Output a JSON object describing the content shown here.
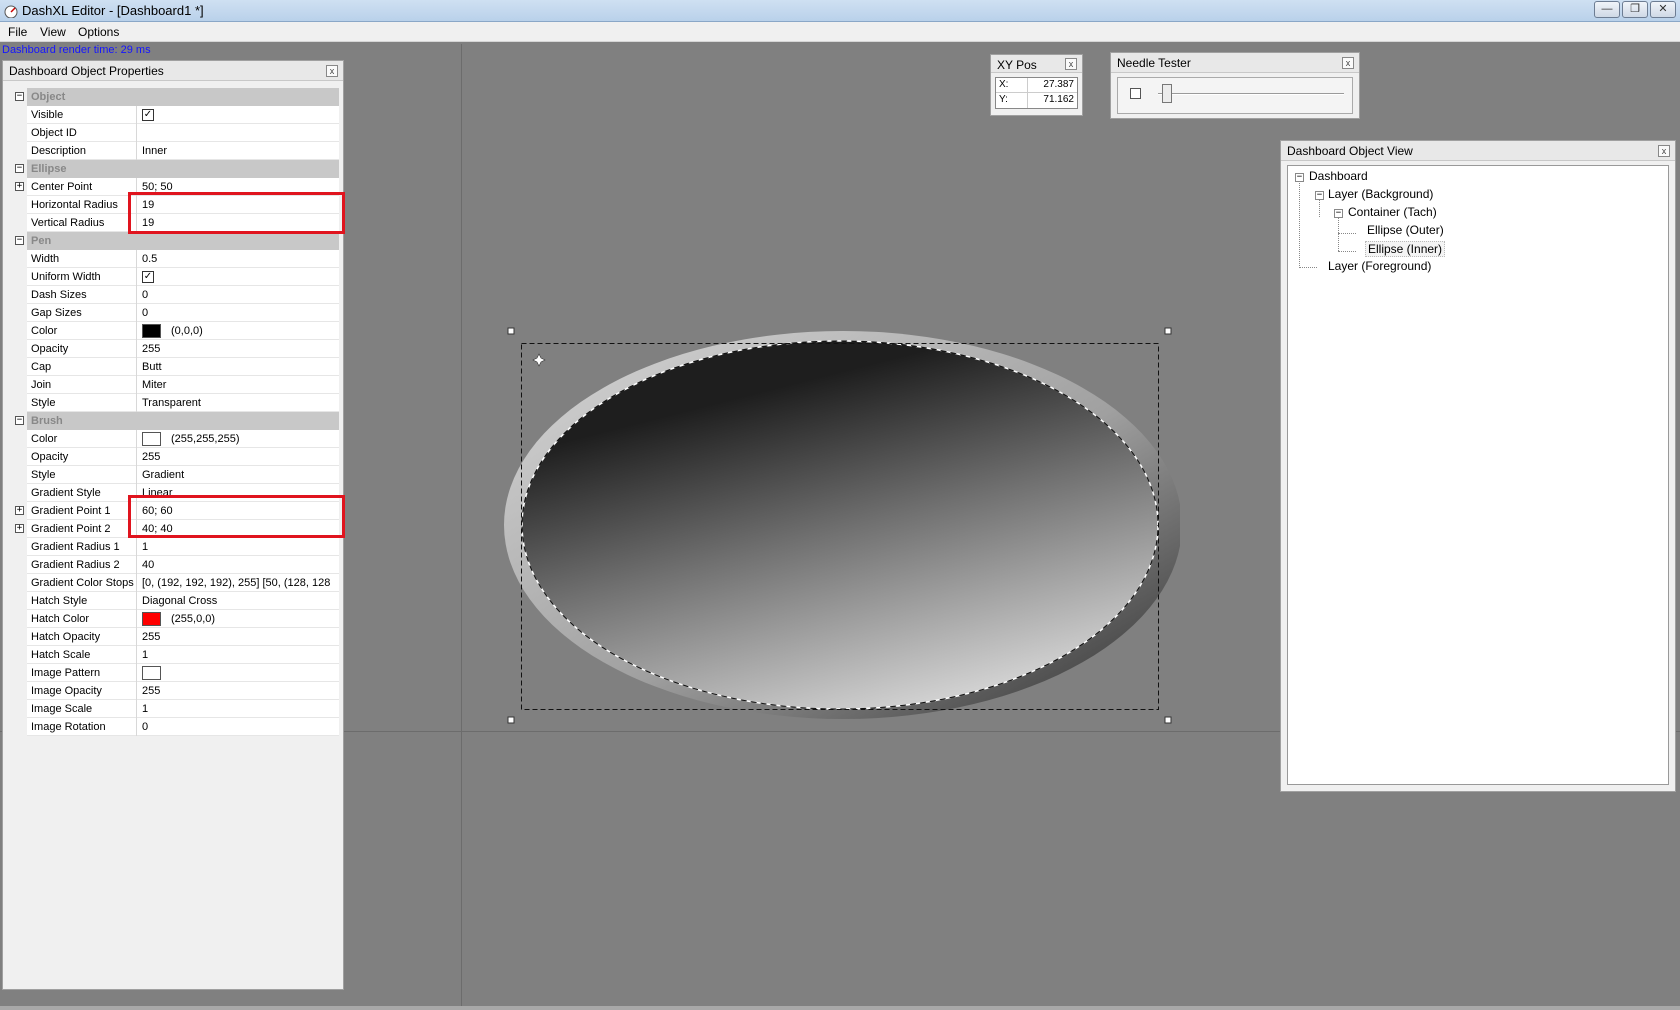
{
  "window": {
    "title": "DashXL Editor - [Dashboard1 *]",
    "controls": {
      "minimize": "—",
      "restore": "❐",
      "close": "✕"
    }
  },
  "menu": {
    "items": [
      "File",
      "View",
      "Options"
    ]
  },
  "status": {
    "render_time": "Dashboard render time: 29 ms"
  },
  "properties_panel": {
    "title": "Dashboard Object Properties",
    "close": "x",
    "rows": [
      {
        "type": "category",
        "name": "Object",
        "expander": "−"
      },
      {
        "type": "check",
        "name": "Visible",
        "checked": true
      },
      {
        "type": "text",
        "name": "Object ID",
        "value": ""
      },
      {
        "type": "text",
        "name": "Description",
        "value": "Inner"
      },
      {
        "type": "category",
        "name": "Ellipse",
        "expander": "−"
      },
      {
        "type": "text",
        "name": "Center Point",
        "value": "50; 50",
        "expander": "+"
      },
      {
        "type": "text",
        "name": "Horizontal Radius",
        "value": "19"
      },
      {
        "type": "text",
        "name": "Vertical Radius",
        "value": "19"
      },
      {
        "type": "category",
        "name": "Pen",
        "expander": "−"
      },
      {
        "type": "text",
        "name": "Width",
        "value": "0.5"
      },
      {
        "type": "check",
        "name": "Uniform Width",
        "checked": true
      },
      {
        "type": "text",
        "name": "Dash Sizes",
        "value": "0"
      },
      {
        "type": "text",
        "name": "Gap Sizes",
        "value": "0"
      },
      {
        "type": "color",
        "name": "Color",
        "value": "(0,0,0)",
        "swatch": "#000000"
      },
      {
        "type": "text",
        "name": "Opacity",
        "value": "255"
      },
      {
        "type": "text",
        "name": "Cap",
        "value": "Butt"
      },
      {
        "type": "text",
        "name": "Join",
        "value": "Miter"
      },
      {
        "type": "text",
        "name": "Style",
        "value": "Transparent"
      },
      {
        "type": "category",
        "name": "Brush",
        "expander": "−"
      },
      {
        "type": "color",
        "name": "Color",
        "value": "(255,255,255)",
        "swatch": "#ffffff"
      },
      {
        "type": "text",
        "name": "Opacity",
        "value": "255"
      },
      {
        "type": "text",
        "name": "Style",
        "value": "Gradient"
      },
      {
        "type": "text",
        "name": "Gradient Style",
        "value": "Linear"
      },
      {
        "type": "text",
        "name": "Gradient Point 1",
        "value": "60; 60",
        "expander": "+"
      },
      {
        "type": "text",
        "name": "Gradient Point 2",
        "value": "40; 40",
        "expander": "+"
      },
      {
        "type": "text",
        "name": "Gradient Radius 1",
        "value": "1"
      },
      {
        "type": "text",
        "name": "Gradient Radius 2",
        "value": "40"
      },
      {
        "type": "text",
        "name": "Gradient Color Stops",
        "value": "[0, (192, 192, 192), 255]  [50, (128, 128"
      },
      {
        "type": "text",
        "name": "Hatch Style",
        "value": "Diagonal Cross"
      },
      {
        "type": "color",
        "name": "Hatch Color",
        "value": "(255,0,0)",
        "swatch": "#ff0000"
      },
      {
        "type": "text",
        "name": "Hatch Opacity",
        "value": "255"
      },
      {
        "type": "text",
        "name": "Hatch Scale",
        "value": "1"
      },
      {
        "type": "color",
        "name": "Image Pattern",
        "value": "",
        "swatch": "#ffffff"
      },
      {
        "type": "text",
        "name": "Image Opacity",
        "value": "255"
      },
      {
        "type": "text",
        "name": "Image Scale",
        "value": "1"
      },
      {
        "type": "text",
        "name": "Image Rotation",
        "value": "0"
      }
    ]
  },
  "xy_pos": {
    "title": "XY Pos",
    "close": "x",
    "x_label": "X:",
    "x_value": "27.387",
    "y_label": "Y:",
    "y_value": "71.162"
  },
  "needle_tester": {
    "title": "Needle Tester",
    "close": "x",
    "level": 0
  },
  "object_view": {
    "title": "Dashboard Object View",
    "close": "x",
    "nodes": {
      "dashboard": "Dashboard",
      "layer_bg": "Layer (Background)",
      "container": "Container (Tach)",
      "outer": "Ellipse (Outer)",
      "inner": "Ellipse (Inner)",
      "layer_fg": "Layer (Foreground)"
    },
    "expander": "−"
  },
  "colors": {
    "highlight_box": "#e0141e",
    "status_text": "#1515ff"
  }
}
